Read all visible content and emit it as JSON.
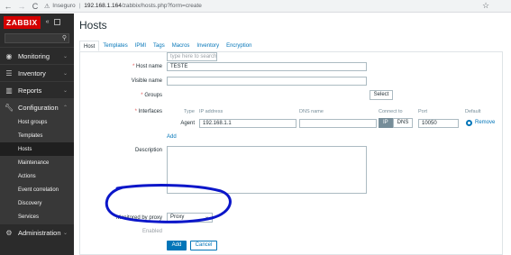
{
  "browser": {
    "back": "←",
    "forward": "→",
    "reload": "C",
    "security": "Inseguro",
    "host": "192.168.1.164",
    "path": "/zabbix/hosts.php?form=create",
    "star": "☆"
  },
  "sidebar": {
    "logo": "ZABBIX",
    "collapse": "«",
    "menu": [
      {
        "label": "Monitoring",
        "icon": "eye-icon"
      },
      {
        "label": "Inventory",
        "icon": "list-icon"
      },
      {
        "label": "Reports",
        "icon": "chart-icon"
      },
      {
        "label": "Configuration",
        "icon": "wrench-icon"
      }
    ],
    "submenu": [
      "Host groups",
      "Templates",
      "Hosts",
      "Maintenance",
      "Actions",
      "Event correlation",
      "Discovery",
      "Services"
    ],
    "admin": {
      "label": "Administration",
      "icon": "gear-icon"
    }
  },
  "page": {
    "title": "Hosts",
    "tabs": [
      "Host",
      "Templates",
      "IPMI",
      "Tags",
      "Macros",
      "Inventory",
      "Encryption"
    ]
  },
  "form": {
    "host_name_label": "Host name",
    "host_name_value": "TESTE",
    "visible_name_label": "Visible name",
    "groups_label": "Groups",
    "groups_placeholder": "type here to search",
    "select_button": "Select",
    "interfaces_label": "Interfaces",
    "iface_headers": {
      "type": "Type",
      "ip": "IP address",
      "dns": "DNS name",
      "connect": "Connect to",
      "port": "Port",
      "default": "Default"
    },
    "iface_row": {
      "type": "Agent",
      "ip": "192.168.1.1",
      "dns": "",
      "ip_toggle": "IP",
      "dns_toggle": "DNS",
      "port": "10050",
      "remove": "Remove"
    },
    "add_link": "Add",
    "description_label": "Description",
    "proxy_label": "Monitored by proxy",
    "proxy_value": "Proxy",
    "enabled_label": "Enabled",
    "add_button": "Add",
    "cancel_button": "Cancel"
  },
  "colors": {
    "sidebar_bg": "#2b2b2b",
    "logo_red": "#d40000",
    "link_blue": "#0275b8",
    "annotation_blue": "#0b16c9"
  }
}
